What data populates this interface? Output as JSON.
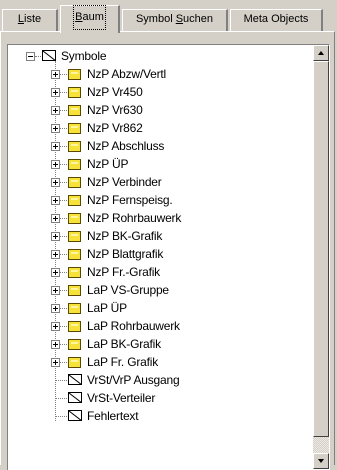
{
  "tabs": [
    {
      "prefix": "",
      "accel": "L",
      "suffix": "iste"
    },
    {
      "prefix": "",
      "accel": "B",
      "suffix": "aum"
    },
    {
      "prefix": "Symbol ",
      "accel": "S",
      "suffix": "uchen"
    },
    {
      "prefix": "Meta Objects",
      "accel": "",
      "suffix": ""
    }
  ],
  "active_tab": "Baum",
  "tree": {
    "root": {
      "label": "Symbole",
      "icon": "symbol-box-icon",
      "expanded": true
    },
    "folders": [
      "NzP Abzw/Vertl",
      "NzP Vr450",
      "NzP Vr630",
      "NzP Vr862",
      "NzP Abschluss",
      "NzP ÜP",
      "NzP Verbinder",
      "NzP Fernspeisg.",
      "NzP Rohrbauwerk",
      "NzP BK-Grafik",
      "NzP Blattgrafik",
      "NzP Fr.-Grafik",
      "LaP VS-Gruppe",
      "LaP ÜP",
      "LaP Rohrbauwerk",
      "LaP BK-Grafik",
      "LaP Fr. Grafik"
    ],
    "symbols": [
      "VrSt/VrP Ausgang",
      "VrSt-Verteiler",
      "Fehlertext"
    ]
  },
  "colors": {
    "face": "#d4d0c8",
    "folder": "#f7e23c",
    "tree_bg": "#ffffff"
  }
}
